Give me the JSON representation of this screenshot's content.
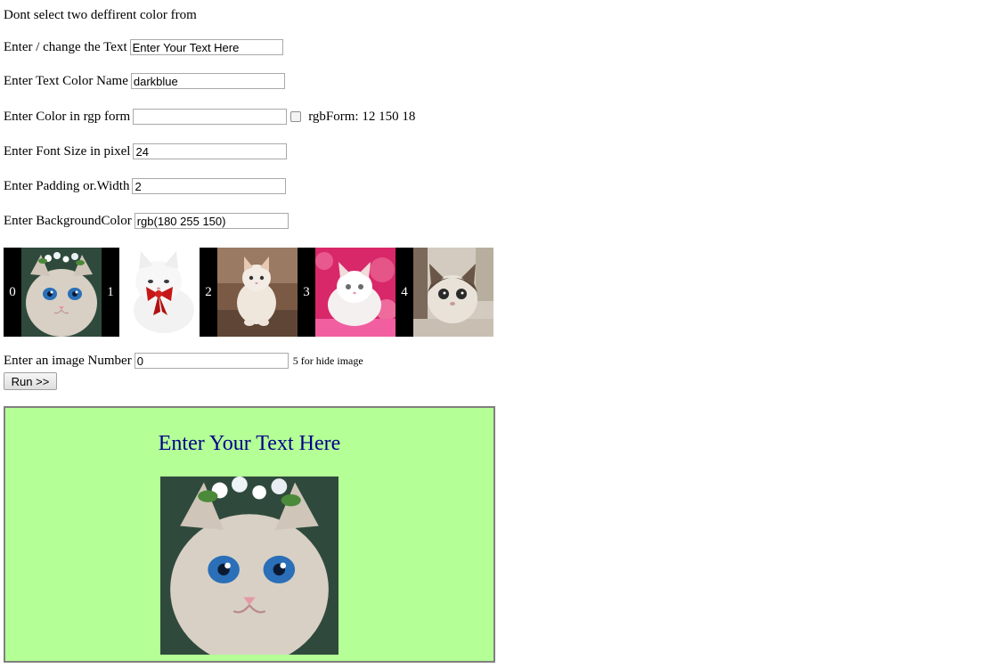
{
  "warning": "Dont select two deffirent color from",
  "fields": {
    "text": {
      "label": "Enter / change the Text",
      "value": "Enter Your Text Here"
    },
    "color_name": {
      "label": "Enter Text Color Name",
      "value": "darkblue"
    },
    "rgb_color": {
      "label": "Enter Color in rgp form",
      "value": "",
      "checkbox_label": "rgbForm: 12 150 18"
    },
    "font_size": {
      "label": "Enter Font Size in pixel",
      "value": "24"
    },
    "padding": {
      "label": "Enter Padding or.Width",
      "value": "2"
    },
    "bg_color": {
      "label": "Enter BackgroundColor",
      "value": "rgb(180 255 150)"
    }
  },
  "image_strip": {
    "numbers": [
      "0",
      "1",
      "2",
      "3",
      "4"
    ]
  },
  "image_number": {
    "label": "Enter an image Number",
    "value": "0",
    "hint": "5 for hide image"
  },
  "run_button": "Run >>",
  "preview": {
    "text": "Enter Your Text Here",
    "text_color": "#00008b",
    "background": "#b4ff96"
  }
}
